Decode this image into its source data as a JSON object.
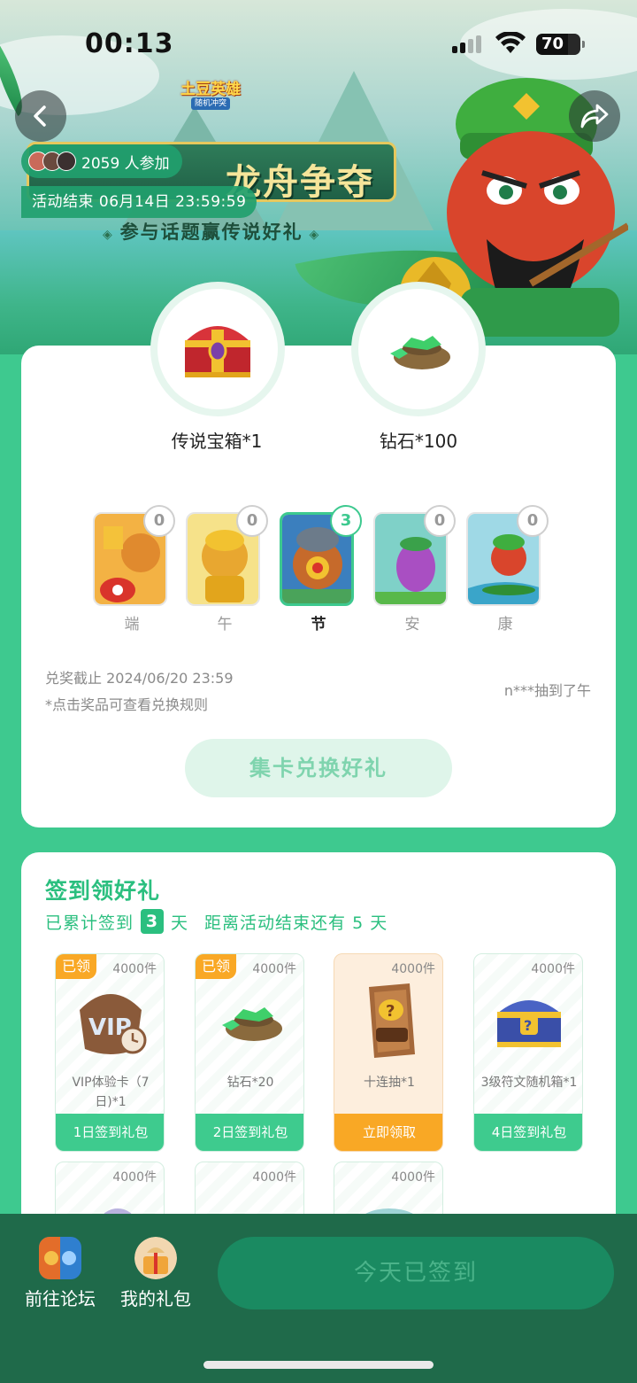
{
  "status_bar": {
    "time": "00:13",
    "battery": "70"
  },
  "hero": {
    "logo_title": "土豆英雄",
    "logo_subtitle": "随机冲突",
    "title": "龙舟争夺",
    "subtitle": "参与话题赢传说好礼",
    "participants": "2059 人参加",
    "end_time": "活动结束 06月14日 23:59:59"
  },
  "prizes": [
    {
      "label": "传说宝箱*1",
      "icon": "treasure-chest-icon"
    },
    {
      "label": "钻石*100",
      "icon": "diamond-bag-icon"
    }
  ],
  "collect_cards": [
    {
      "label": "端",
      "count": "0",
      "active": false
    },
    {
      "label": "午",
      "count": "0",
      "active": false
    },
    {
      "label": "节",
      "count": "3",
      "active": true
    },
    {
      "label": "安",
      "count": "0",
      "active": false
    },
    {
      "label": "康",
      "count": "0",
      "active": false
    }
  ],
  "redeem": {
    "deadline": "兑奖截止 2024/06/20 23:59",
    "note": "*点击奖品可查看兑换规则",
    "ticker": "n***抽到了午",
    "button": "集卡兑换好礼"
  },
  "signin": {
    "title": "签到领好礼",
    "status_prefix": "已累计签到",
    "days": "3",
    "status_mid": "天",
    "status_suffix": "距离活动结束还有 5 天",
    "rewards": [
      {
        "qty": "4000件",
        "claimed": "已领",
        "name": "VIP体验卡（7日)*1",
        "button": "1日签到礼包",
        "icon": "vip-card-icon"
      },
      {
        "qty": "4000件",
        "claimed": "已领",
        "name": "钻石*20",
        "button": "2日签到礼包",
        "icon": "diamond-bag-icon"
      },
      {
        "qty": "4000件",
        "name": "十连抽*1",
        "button": "立即领取",
        "icon": "ten-draw-ticket-icon"
      },
      {
        "qty": "4000件",
        "name": "3级符文随机箱*1",
        "button": "4日签到礼包",
        "icon": "rune-chest-icon"
      },
      {
        "qty": "4000件"
      },
      {
        "qty": "4000件"
      },
      {
        "qty": "4000件"
      }
    ]
  },
  "bottom_bar": {
    "forum": "前往论坛",
    "gifts": "我的礼包",
    "signed": "今天已签到"
  }
}
